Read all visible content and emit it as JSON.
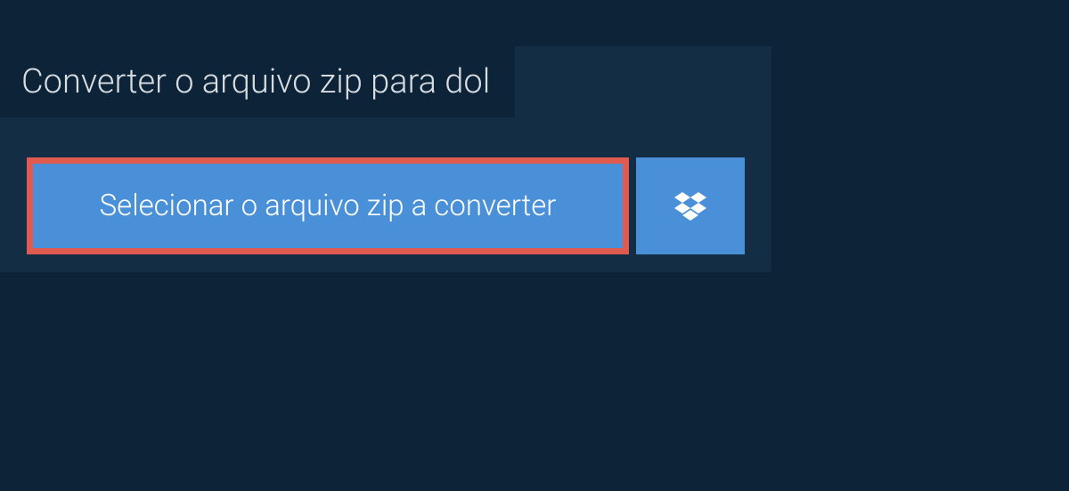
{
  "title": "Converter o arquivo zip para dol",
  "selectButton": "Selecionar o arquivo zip a converter"
}
